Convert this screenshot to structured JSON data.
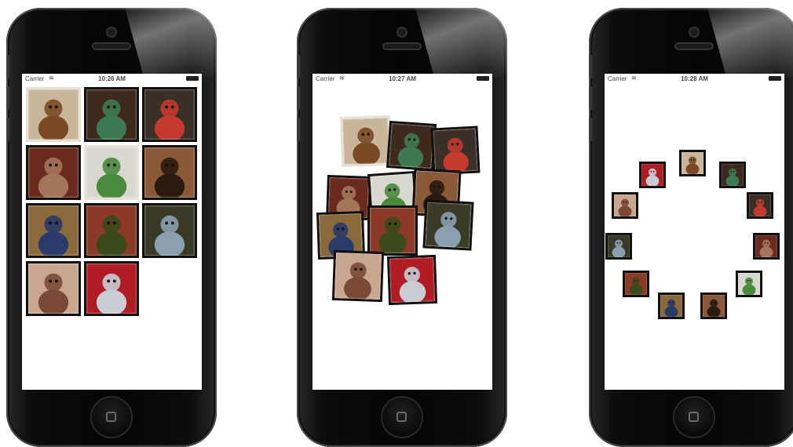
{
  "phones": [
    {
      "status": {
        "carrier": "Carrier",
        "time": "10:26 AM"
      },
      "photos": [
        {
          "name": "photo-monkey-with-paper",
          "bg": "#c8b59a",
          "fg": "#7a4a24"
        },
        {
          "name": "photo-pool-table-monkey",
          "bg": "#3e2a1c",
          "fg": "#3d7a52"
        },
        {
          "name": "photo-toys-pile",
          "bg": "#3a3028",
          "fg": "#c43a2e"
        },
        {
          "name": "photo-monkey-bed",
          "bg": "#6b2a1e",
          "fg": "#a3765a"
        },
        {
          "name": "photo-green-hat-toy",
          "bg": "#d8d8d0",
          "fg": "#4a8a3c"
        },
        {
          "name": "photo-monkey-silhouette",
          "bg": "#8a5a38",
          "fg": "#2a1a10"
        },
        {
          "name": "photo-blue-shirt-monkey",
          "bg": "#8a6a3a",
          "fg": "#2a3a6a"
        },
        {
          "name": "photo-party-toys",
          "bg": "#8a3a26",
          "fg": "#3a4a1a"
        },
        {
          "name": "photo-jar-toy",
          "bg": "#3a3a26",
          "fg": "#8aa0b0"
        },
        {
          "name": "photo-monkey-hug",
          "bg": "#c8a690",
          "fg": "#7a4a34"
        },
        {
          "name": "photo-can-toy-red",
          "bg": "#b01c24",
          "fg": "#c8ccd4"
        }
      ]
    },
    {
      "status": {
        "carrier": "Carrier",
        "time": "10:27 AM"
      }
    },
    {
      "status": {
        "carrier": "Carrier",
        "time": "10:28 AM"
      }
    }
  ]
}
